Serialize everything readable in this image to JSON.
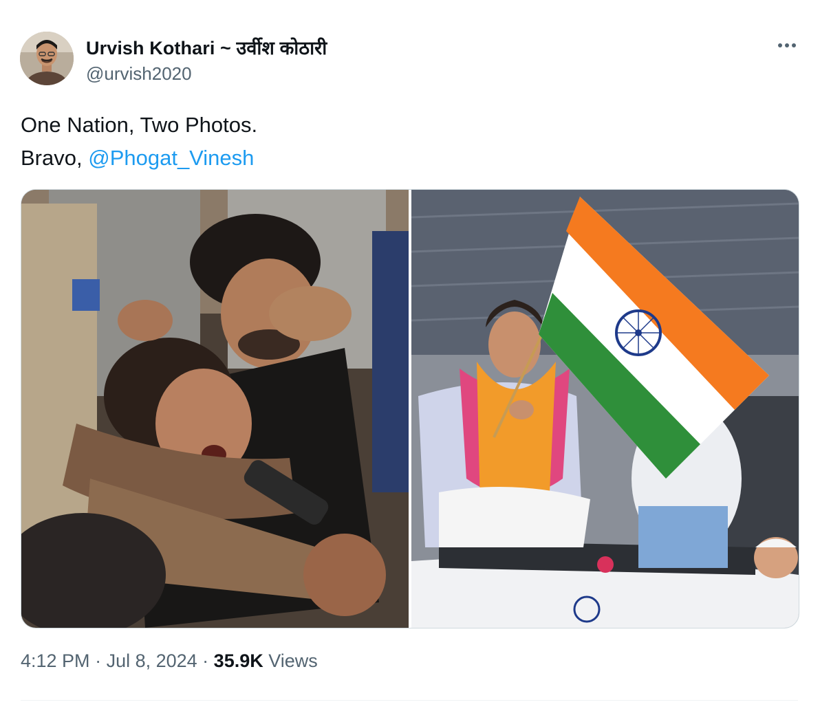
{
  "author": {
    "display_name": "Urvish Kothari ~ उर्वीश कोठारी",
    "handle": "@urvish2020"
  },
  "tweet": {
    "line1": "One Nation, Two Photos.",
    "line2_prefix": "Bravo, ",
    "mention": "@Phogat_Vinesh"
  },
  "media": {
    "left_photo": "protest-scene",
    "right_photo": "celebration-with-flag"
  },
  "footer": {
    "time": "4:12 PM",
    "sep1": " · ",
    "date": "Jul 8, 2024",
    "sep2": " · ",
    "views_count": "35.9K",
    "views_label": " Views"
  },
  "icons": {
    "more": "more-horizontal-icon"
  },
  "colors": {
    "accent": "#1d9bf0",
    "text": "#0f1419",
    "secondary": "#536471",
    "saffron": "#f57a1f",
    "green": "#2f8f3a",
    "chakra": "#1e3a8a"
  }
}
